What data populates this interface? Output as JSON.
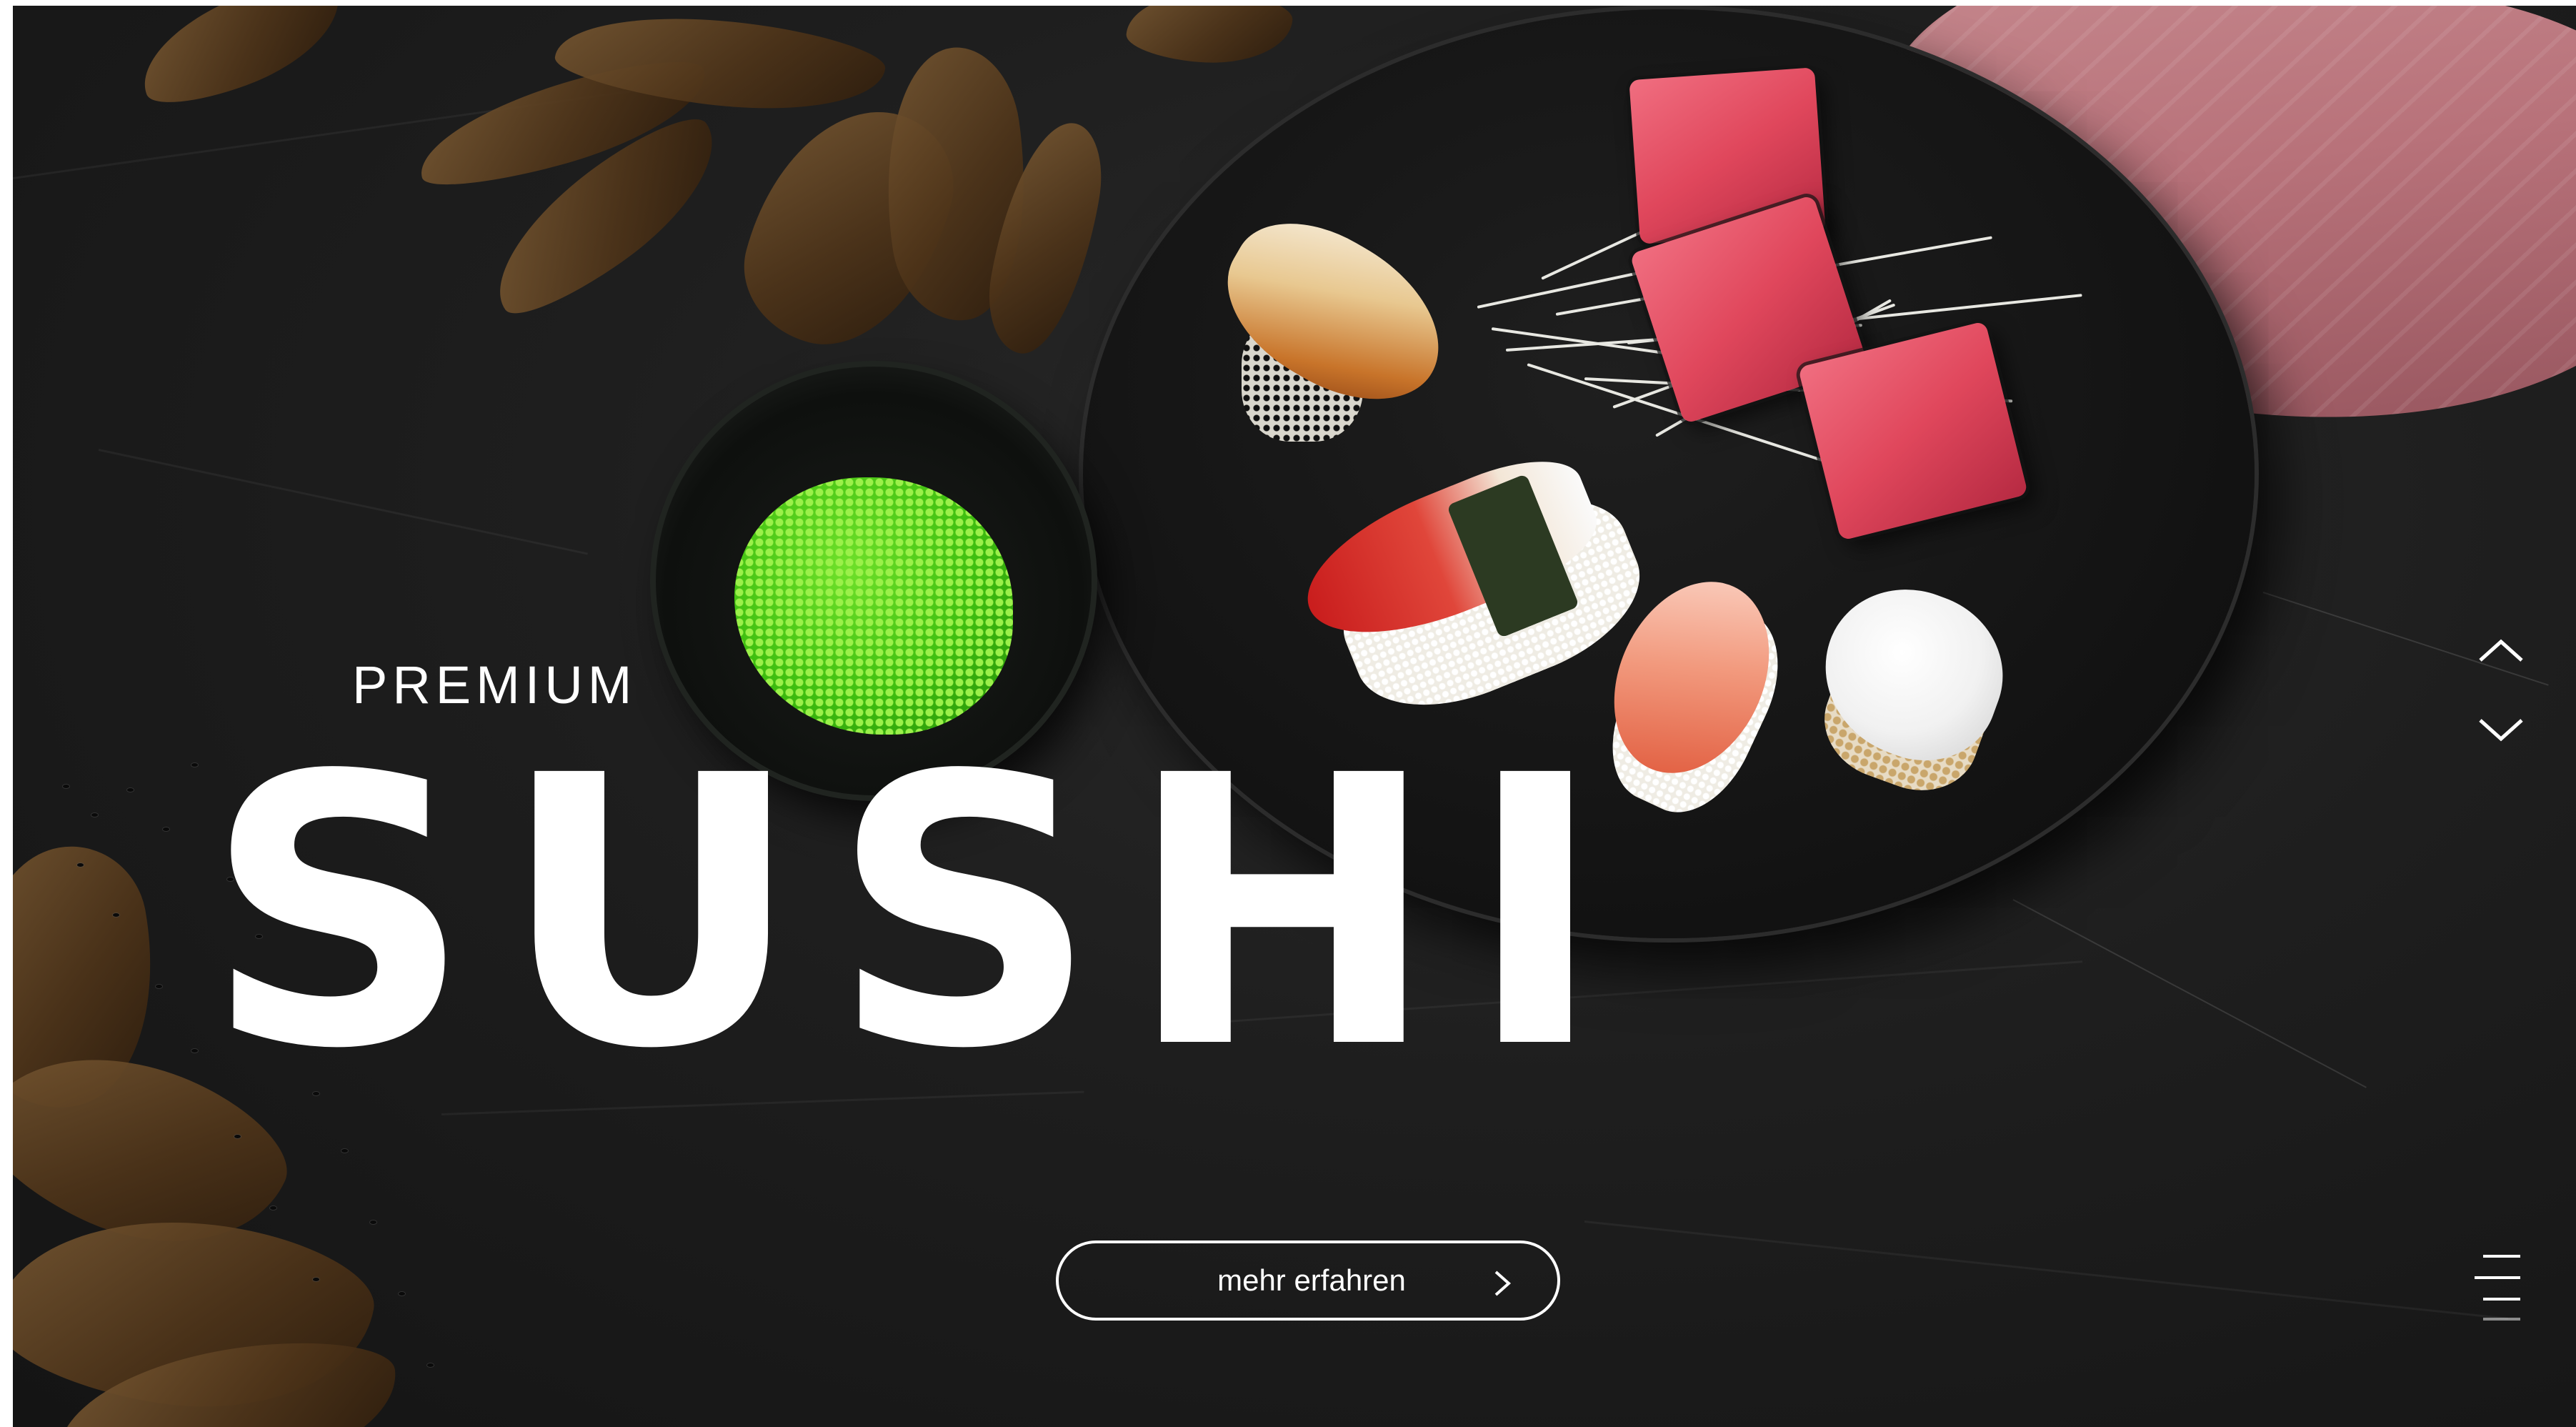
{
  "hero": {
    "eyebrow": "PREMIUM",
    "headline": "SUSHI"
  },
  "cta": {
    "label": "mehr erfahren",
    "icon": "chevron-right-icon"
  },
  "slide_navigation": {
    "up_icon": "chevron-up-icon",
    "down_icon": "chevron-down-icon"
  },
  "menu": {
    "icon": "hamburger-menu-icon"
  },
  "colors": {
    "background": "#1e1e1e",
    "text": "#ffffff",
    "accent_tuna": "#e0475c",
    "accent_tobiko": "#3fbf10"
  }
}
